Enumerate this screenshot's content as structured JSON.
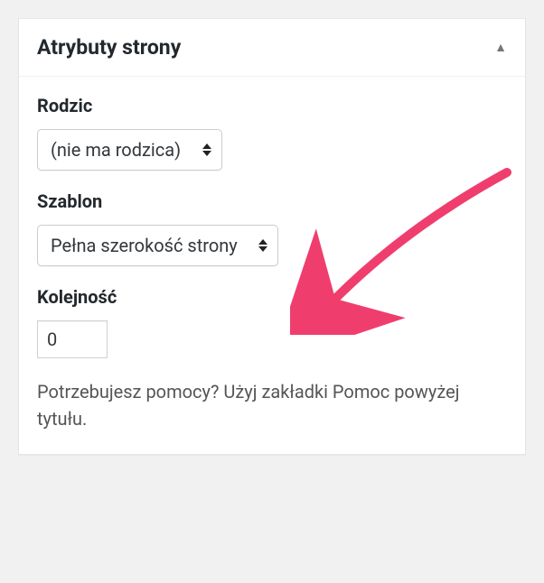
{
  "panel": {
    "title": "Atrybuty strony"
  },
  "fields": {
    "parent": {
      "label": "Rodzic",
      "value": "(nie ma rodzica)"
    },
    "template": {
      "label": "Szablon",
      "value": "Pełna szerokość strony"
    },
    "order": {
      "label": "Kolejność",
      "value": "0"
    }
  },
  "help": "Potrzebujesz pomocy? Użyj zakładki Pomoc powyżej tytułu.",
  "annotation": {
    "arrow_color": "#ef3e6d"
  }
}
